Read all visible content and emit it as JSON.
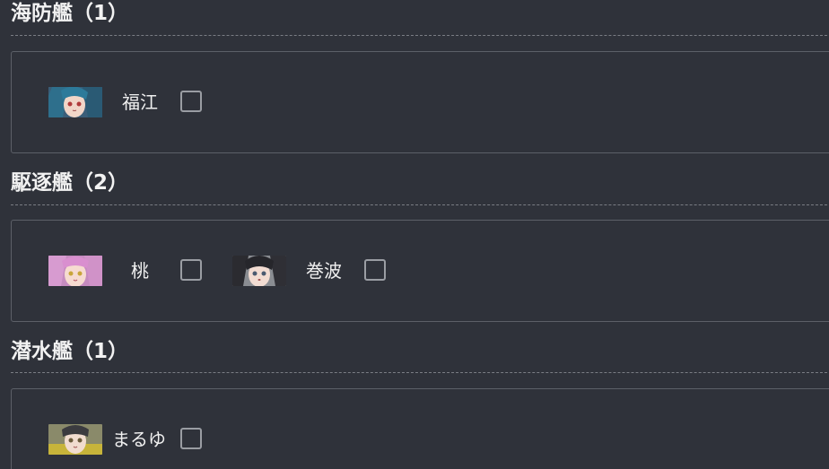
{
  "sections": [
    {
      "title": "海防艦（1）",
      "ships": [
        {
          "name": "福江",
          "checked": false,
          "banner_icon": "fukae-portrait"
        }
      ]
    },
    {
      "title": "駆逐艦（2）",
      "ships": [
        {
          "name": "桃",
          "checked": false,
          "banner_icon": "momo-portrait"
        },
        {
          "name": "巻波",
          "checked": false,
          "banner_icon": "makinami-portrait"
        }
      ]
    },
    {
      "title": "潜水艦（1）",
      "ships": [
        {
          "name": "まるゆ",
          "checked": false,
          "banner_icon": "maruyu-portrait"
        }
      ]
    }
  ],
  "colors": {
    "background": "#2f323a",
    "panel_border": "#5c6068",
    "checkbox_border": "#9a9da3",
    "text": "#f0f0f0"
  }
}
